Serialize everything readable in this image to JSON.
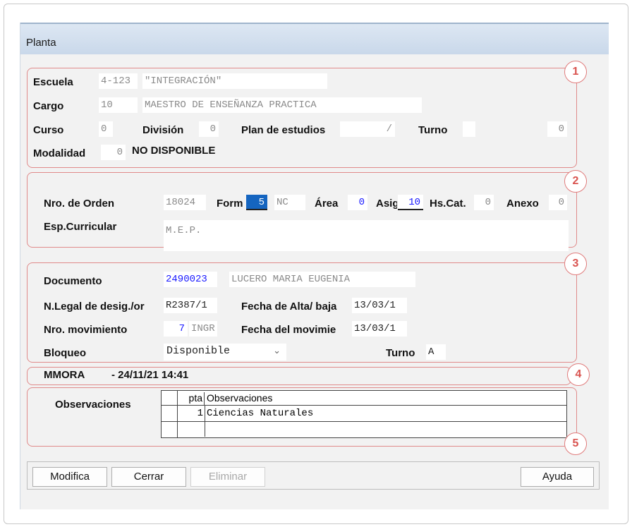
{
  "window": {
    "title": "Planta"
  },
  "badges": [
    "1",
    "2",
    "3",
    "4",
    "5"
  ],
  "section1": {
    "escuela_label": "Escuela",
    "escuela_code": "4-123",
    "escuela_name": "\"INTEGRACIÓN\"",
    "cargo_label": "Cargo",
    "cargo_code": "10",
    "cargo_name": "MAESTRO DE ENSEÑANZA PRACTICA",
    "curso_label": "Curso",
    "curso_value": "0",
    "division_label": "División",
    "division_value": "0",
    "plan_label": "Plan de estudios",
    "plan_value": "/",
    "turno_label": "Turno",
    "turno_value": "",
    "turno_extra": "0",
    "modalidad_label": "Modalidad",
    "modalidad_value": "0",
    "modalidad_text": "NO DISPONIBLE"
  },
  "section2": {
    "nro_orden_label": "Nro. de Orden",
    "nro_orden_value": "18024",
    "form_label": "Form",
    "form_value": "5",
    "form_extra": "NC",
    "area_label": "Área",
    "area_value": "0",
    "asig_label": "Asig",
    "asig_value": "10",
    "hscat_label": "Hs.Cat.",
    "hscat_value": "0",
    "anexo_label": "Anexo",
    "anexo_value": "0",
    "esp_label": "Esp.Curricular",
    "esp_value": "M.E.P."
  },
  "section3": {
    "documento_label": "Documento",
    "documento_value": "2490023",
    "documento_name": "LUCERO MARIA EUGENIA",
    "nlegal_label": "N.Legal de desig./or",
    "nlegal_value": "R2387/1",
    "fecha_alta_label": "Fecha de Alta/ baja",
    "fecha_alta_value": "13/03/1",
    "nro_mov_label": "Nro. movimiento",
    "nro_mov_value": "7",
    "nro_mov_extra": "INGR",
    "fecha_mov_label": "Fecha del movimie",
    "fecha_mov_value": "13/03/1",
    "bloqueo_label": "Bloqueo",
    "bloqueo_value": "Disponible",
    "turno_label": "Turno",
    "turno_value": "A"
  },
  "section4": {
    "user": "MMORA",
    "timestamp": "- 24/11/21 14:41"
  },
  "section5": {
    "label": "Observaciones",
    "columns": [
      "pta",
      "Observaciones"
    ],
    "rows": [
      {
        "pta": "1",
        "obs": "Ciencias Naturales"
      }
    ]
  },
  "buttons": {
    "modifica": "Modifica",
    "cerrar": "Cerrar",
    "eliminar": "Eliminar",
    "ayuda": "Ayuda"
  }
}
